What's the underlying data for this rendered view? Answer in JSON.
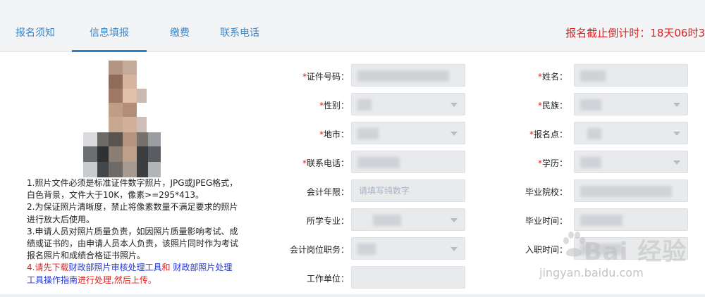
{
  "tabs": [
    {
      "label": "报名须知",
      "active": false
    },
    {
      "label": "信息填报",
      "active": true
    },
    {
      "label": "缴费",
      "active": false
    },
    {
      "label": "联系电话",
      "active": false
    }
  ],
  "countdown": "报名截止倒计时：18天06时3",
  "notes": {
    "n1": "1.照片文件必须是标准证件数字照片，JPG或JPEG格式，白色背景，文件大于10K，像素>=295*413。",
    "n2": "2.为保证照片清晰度，禁止将像素数量不满足要求的照片进行放大后使用。",
    "n3": "3.申请人员对照片质量负责，如因照片质量影响考试、成绩或证书的，由申请人员本人负责，该照片同时作为考试报名照片和成绩合格证书照片。",
    "n4_prefix": "4.",
    "n4_red1": "请先下载",
    "n4_blue1": "财政部照片审核处理工具",
    "n4_red2": "和 ",
    "n4_blue2": "财政部照片处理工具操作指南",
    "n4_red3": "进行处理,然后上传。"
  },
  "form": {
    "id_number": "证件号码：",
    "name": "姓名：",
    "gender": "性别：",
    "ethnicity": "民族：",
    "city": "地市：",
    "site": "报名点：",
    "phone": "联系电话：",
    "education": "学历：",
    "years": "会计年限：",
    "years_placeholder": "请填写纯数字",
    "school": "毕业院校：",
    "major": "所学专业：",
    "grad_time": "毕业时间：",
    "position": "会计岗位职务：",
    "join_time": "入职时间：",
    "employer": "工作单位："
  },
  "watermark": {
    "brand": "Bai  经验",
    "url": "jingyan.baidu.com"
  }
}
